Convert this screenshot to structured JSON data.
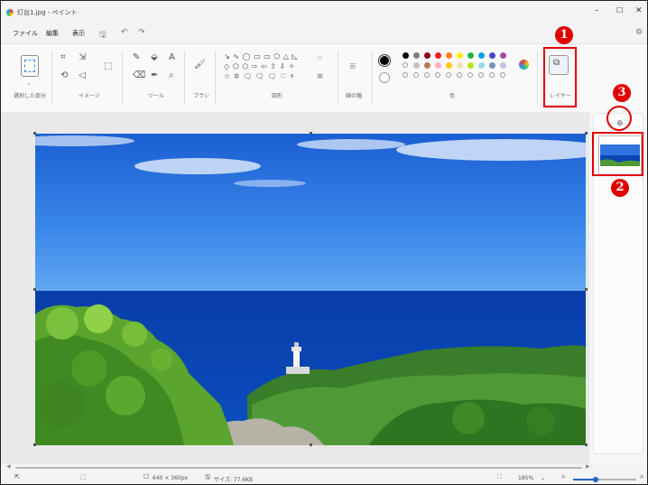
{
  "window": {
    "title": "灯台1.jpg - ペイント",
    "minimize": "–",
    "maximize": "☐",
    "close": "✕"
  },
  "menu": {
    "file": "ファイル",
    "edit": "編集",
    "view": "表示",
    "save_icon": "🖫",
    "undo_icon": "↶",
    "redo_icon": "↷",
    "settings_icon": "⚙"
  },
  "ribbon": {
    "groups": {
      "selection": "選択した部分",
      "image": "イメージ",
      "tools": "ツール",
      "brush": "ブラシ",
      "shapes": "図形",
      "stroke": "線の幅",
      "colors": "色",
      "layers": "レイヤー"
    },
    "shape_rows": [
      "↘ ∿ ◯ ▭ ▭ ⬠ △ ◺",
      "◇ ⬠ ⬡ ⇨ ⇦ ⇧ ⇩ ✧",
      "☆ ✡ 🗨 🗨 🗨 ♡ ⚡"
    ],
    "text_tool": "A",
    "colors_row1": [
      "#000000",
      "#7f7f7f",
      "#880015",
      "#ed1c24",
      "#ff7f27",
      "#fff200",
      "#22b14c",
      "#00a2e8",
      "#3f48cc",
      "#a349a4"
    ],
    "colors_row2": [
      "#ffffff",
      "#c3c3c3",
      "#b97a57",
      "#ffaec9",
      "#ffc90e",
      "#efe4b0",
      "#b5e61d",
      "#99d9ea",
      "#7092be",
      "#c8bfe7"
    ],
    "primary_color": "#000000",
    "secondary_color": "#ffffff"
  },
  "status": {
    "canvas_size": "640 × 360px",
    "file_size": "サイズ: 77.6KB",
    "zoom": "185%",
    "zoom_level": 0.35
  },
  "annotations": {
    "badge1": "1",
    "badge2": "2",
    "badge3": "3"
  },
  "layers_panel": {
    "add_icon": "⊕"
  }
}
